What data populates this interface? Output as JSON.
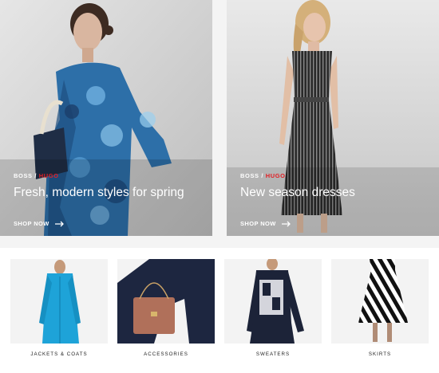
{
  "heroes": [
    {
      "brand_a": "BOSS",
      "sep": " / ",
      "brand_b": "HUGO",
      "headline": "Fresh, modern styles for spring",
      "cta": "SHOP NOW"
    },
    {
      "brand_a": "BOSS",
      "sep": " / ",
      "brand_b": "HUGO",
      "headline": "New season dresses",
      "cta": "SHOP NOW"
    }
  ],
  "categories": [
    {
      "label": "JACKETS & COATS"
    },
    {
      "label": "ACCESSORIES"
    },
    {
      "label": "SWEATERS"
    },
    {
      "label": "SKIRTS"
    }
  ],
  "colors": {
    "accent_red": "#e31e24",
    "text_white": "#ffffff"
  },
  "icons": [
    "arrow-right-icon"
  ]
}
